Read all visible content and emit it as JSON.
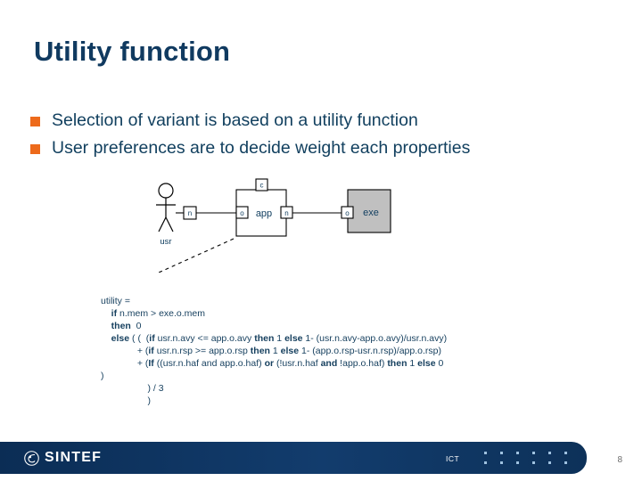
{
  "slide": {
    "title": "Utility function",
    "page_number": "8"
  },
  "bullets": [
    {
      "marker": "square-bullet",
      "text": "Selection of variant is based on a utility function"
    },
    {
      "marker": "square-bullet",
      "text": "User preferences are to decide weight each properties"
    }
  ],
  "diagram": {
    "actor": {
      "label": "usr",
      "icon": "stick-figure-actor-icon"
    },
    "actor_port": {
      "letter": "n"
    },
    "app_component": {
      "label": "app",
      "ports": {
        "top": "c",
        "left": "o",
        "right": "n"
      }
    },
    "exe_component": {
      "label": "exe",
      "ports": {
        "left": "o"
      },
      "fill_color": "#c0c0c0"
    },
    "connector_note": "dashed-leader-line"
  },
  "formula": {
    "lines": [
      {
        "indent": 0,
        "parts": [
          {
            "t": "utility =",
            "b": false
          }
        ]
      },
      {
        "indent": 1,
        "parts": [
          {
            "t": "if",
            "b": true
          },
          {
            "t": " n.mem > exe.o.mem",
            "b": false
          }
        ]
      },
      {
        "indent": 1,
        "parts": [
          {
            "t": "then",
            "b": true
          },
          {
            "t": "  0",
            "b": false
          }
        ]
      },
      {
        "indent": 1,
        "parts": [
          {
            "t": "else",
            "b": true
          },
          {
            "t": " ( (  (",
            "b": false
          },
          {
            "t": "if",
            "b": true
          },
          {
            "t": " usr.n.avy <= app.o.avy ",
            "b": false
          },
          {
            "t": "then",
            "b": true
          },
          {
            "t": " 1 ",
            "b": false
          },
          {
            "t": "else",
            "b": true
          },
          {
            "t": " 1- (usr.n.avy-app.o.avy)/usr.n.avy)",
            "b": false
          }
        ]
      },
      {
        "indent": 3,
        "parts": [
          {
            "t": "+ (",
            "b": false
          },
          {
            "t": "if",
            "b": true
          },
          {
            "t": " usr.n.rsp >= app.o.rsp ",
            "b": false
          },
          {
            "t": "then",
            "b": true
          },
          {
            "t": " 1 ",
            "b": false
          },
          {
            "t": "else",
            "b": true
          },
          {
            "t": " 1- (app.o.rsp-usr.n.rsp)/app.o.rsp)",
            "b": false
          }
        ]
      },
      {
        "indent": 3,
        "parts": [
          {
            "t": "+ (",
            "b": false
          },
          {
            "t": "If",
            "b": true
          },
          {
            "t": " ((usr.n.haf and app.o.haf) ",
            "b": false
          },
          {
            "t": "or",
            "b": true
          },
          {
            "t": " (!usr.n.haf ",
            "b": false
          },
          {
            "t": "and",
            "b": true
          },
          {
            "t": " !app.o.haf) ",
            "b": false
          },
          {
            "t": "then",
            "b": true
          },
          {
            "t": " 1 ",
            "b": false
          },
          {
            "t": "else",
            "b": true
          },
          {
            "t": " 0",
            "b": false
          }
        ]
      },
      {
        "indent": 0,
        "parts": [
          {
            "t": ")",
            "b": false
          }
        ]
      },
      {
        "indent": 4,
        "parts": [
          {
            "t": ") / 3",
            "b": false
          }
        ]
      },
      {
        "indent": 4,
        "parts": [
          {
            "t": ")",
            "b": false
          }
        ]
      }
    ]
  },
  "footer": {
    "logo_text": "SINTEF",
    "unit_label": "ICT"
  },
  "colors": {
    "title": "#103a60",
    "body_text": "#12405f",
    "bullet_marker": "#ED6A1B",
    "footer_bar": "#0e3360",
    "dot": "#9fc2e0",
    "exe_fill": "#c0c0c0"
  }
}
